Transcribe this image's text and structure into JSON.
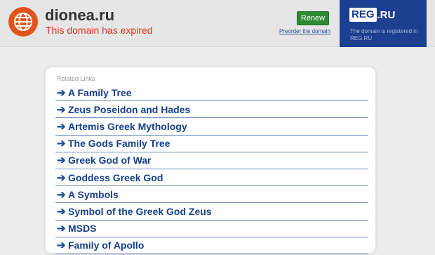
{
  "header": {
    "domain": "dionea.ru",
    "status": "This domain has expired",
    "renew_label": "Renew",
    "preorder_label": "Preorder the domain"
  },
  "registrar": {
    "logo_main": "REG",
    "logo_suffix": ".RU",
    "note": "The domain is registered in REG.RU"
  },
  "related": {
    "title": "Related Links",
    "links": [
      "A Family Tree",
      "Zeus Poseidon and Hades",
      "Artemis Greek Mythology",
      "The Gods Family Tree",
      "Greek God of War",
      "Goddess Greek God",
      "A Symbols",
      "Symbol of the Greek God Zeus",
      "MSDS",
      "Family of Apollo"
    ]
  },
  "colors": {
    "accent": "#e2541d",
    "expired": "#e2301b",
    "renew": "#2e8b35",
    "registrar": "#1c3f8f",
    "link": "#163f8a"
  },
  "icons": {
    "logo": "globe-icon",
    "bullet": "arrow-right-icon"
  }
}
